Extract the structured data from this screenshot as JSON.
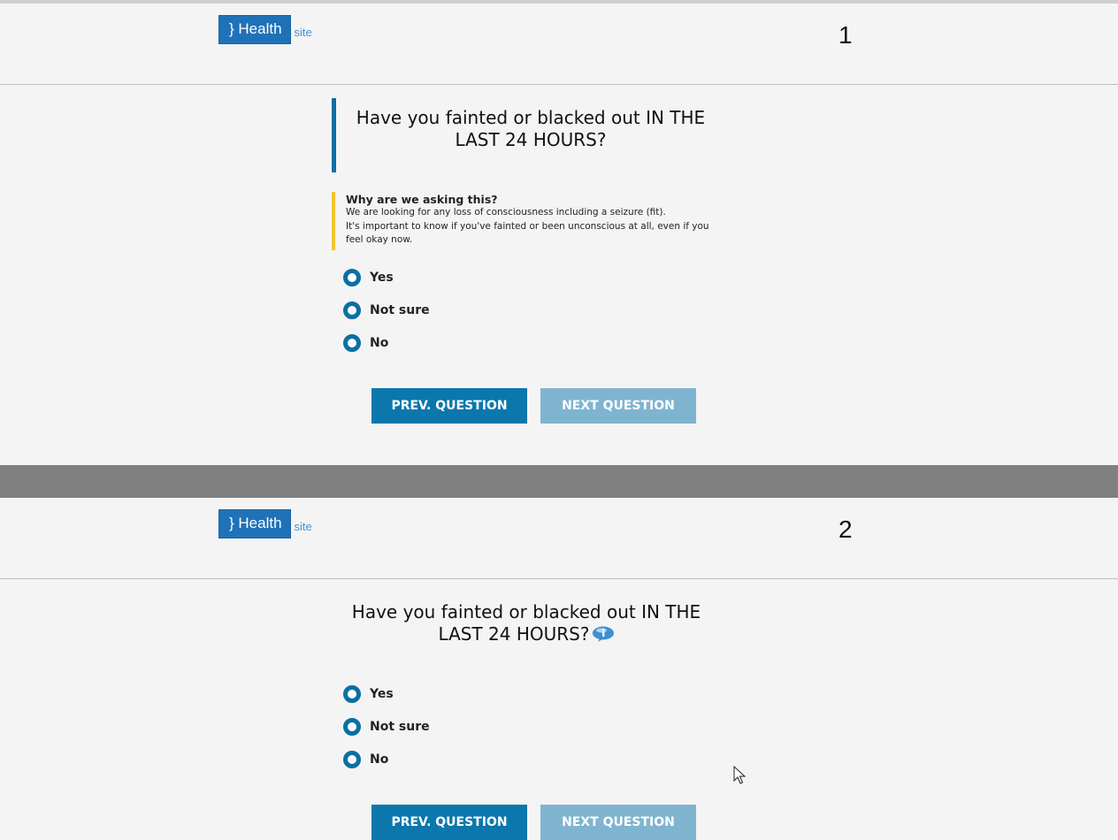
{
  "panels": [
    {
      "number": "1",
      "logo": {
        "text": "} Health",
        "suffix": "site"
      },
      "question": "Have you fainted or blacked out IN THE LAST 24 HOURS?",
      "why": {
        "title": "Why are we asking this?",
        "line1": "We are looking for any loss of consciousness including a seizure (fit).",
        "line2": "It's important to know if you've fainted or been unconscious at all, even if you feel okay now."
      },
      "options": [
        "Yes",
        "Not sure",
        "No"
      ],
      "buttons": {
        "prev": "PREV. QUESTION",
        "next": "NEXT QUESTION"
      }
    },
    {
      "number": "2",
      "logo": {
        "text": "} Health",
        "suffix": "site"
      },
      "question": "Have you fainted or blacked out IN THE LAST 24 HOURS?",
      "options": [
        "Yes",
        "Not sure",
        "No"
      ],
      "buttons": {
        "prev": "PREV. QUESTION",
        "next": "NEXT QUESTION"
      }
    }
  ],
  "colors": {
    "brand_blue": "#1f72b8",
    "accent_blue": "#0b6fa4",
    "button_blue": "#0b77ad",
    "button_disabled": "#7fb4d1",
    "info_yellow": "#f4c531",
    "separator_gray": "#808080"
  },
  "icons": [
    "info-speech-bubble-icon",
    "mouse-cursor-icon"
  ]
}
